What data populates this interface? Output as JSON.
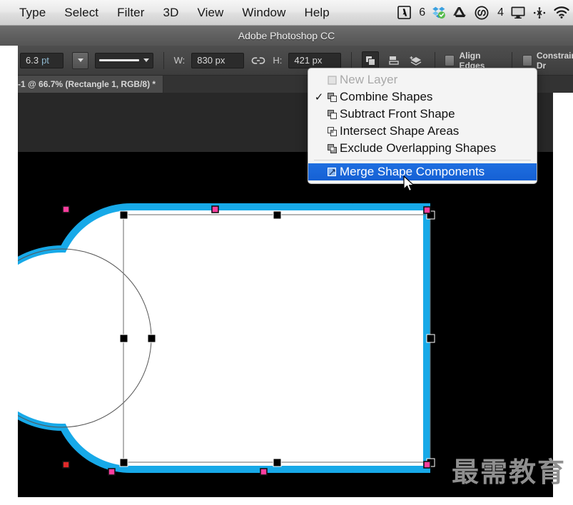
{
  "menubar": {
    "items": [
      "Type",
      "Select",
      "Filter",
      "3D",
      "View",
      "Window",
      "Help"
    ],
    "status_icons": [
      {
        "name": "adobe-app-icon",
        "badge": "6"
      },
      {
        "name": "dropbox-icon",
        "badge": ""
      },
      {
        "name": "google-drive-icon",
        "badge": ""
      },
      {
        "name": "creative-cloud-icon",
        "badge": "4"
      },
      {
        "name": "display-icon",
        "badge": ""
      },
      {
        "name": "bluetooth-sharing-icon",
        "badge": ""
      },
      {
        "name": "wifi-icon",
        "badge": ""
      }
    ]
  },
  "titlebar": {
    "title": "Adobe Photoshop CC"
  },
  "options_bar": {
    "stroke_width_value": "6.3",
    "stroke_width_unit": "pt",
    "stroke_style_label": "stroke-preset",
    "width_label": "W:",
    "width_value": "830 px",
    "link_icon": "chain-link-icon",
    "height_label": "H:",
    "height_value": "421 px",
    "path_ops_icon": "path-operations-icon",
    "path_align_icon": "path-alignment-icon",
    "path_arrange_icon": "path-arrangement-icon",
    "align_edges_label": "Align Edges",
    "constrain_label": "Constrain Path Dr"
  },
  "document_tab": {
    "title": "-1 @ 66.7% (Rectangle 1, RGB/8) *"
  },
  "menu": {
    "items": [
      {
        "label": "New Layer",
        "icon": "new-layer-icon",
        "checked": false,
        "disabled": true,
        "selected": false
      },
      {
        "label": "Combine Shapes",
        "icon": "combine-shapes-icon",
        "checked": true,
        "disabled": false,
        "selected": false
      },
      {
        "label": "Subtract Front Shape",
        "icon": "subtract-front-shape-icon",
        "checked": false,
        "disabled": false,
        "selected": false
      },
      {
        "label": "Intersect Shape Areas",
        "icon": "intersect-shape-areas-icon",
        "checked": false,
        "disabled": false,
        "selected": false
      },
      {
        "label": "Exclude Overlapping Shapes",
        "icon": "exclude-overlapping-shapes-icon",
        "checked": false,
        "disabled": false,
        "selected": false
      },
      {
        "label": "Merge Shape Components",
        "icon": "merge-shape-components-icon",
        "checked": false,
        "disabled": false,
        "selected": true
      }
    ],
    "check_glyph": "✓",
    "highlight_color": "#1560d4"
  },
  "canvas": {
    "background_color": "#000000",
    "shape_fill_color": "#ffffff",
    "shape_stroke_color": "#17a9e8",
    "anchor_point_color": "#ff3e9e",
    "transform_handle_color": "#000000",
    "path_outline_color": "#555555",
    "watermark_text": "最需教育"
  }
}
